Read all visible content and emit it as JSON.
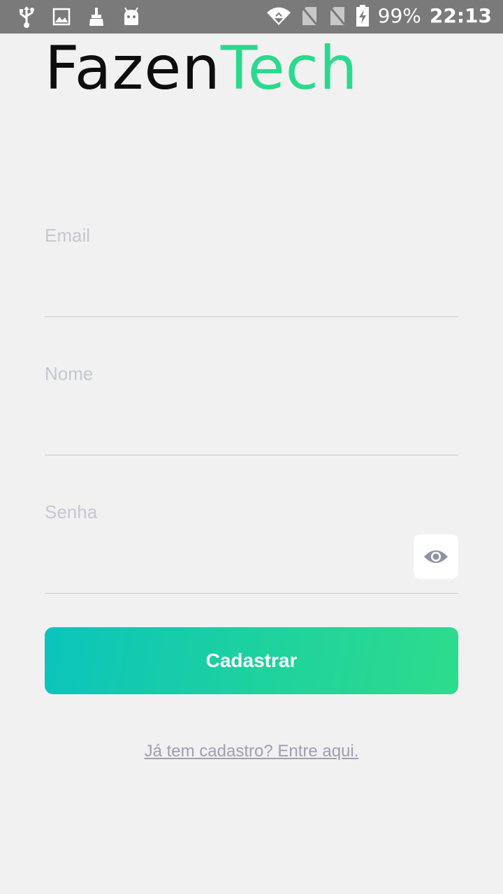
{
  "status_bar": {
    "battery": "99%",
    "time": "22:13",
    "left_icons": [
      "usb-icon",
      "image-icon",
      "cleaner-icon",
      "android-icon"
    ],
    "right_icons": [
      "wifi-icon",
      "no-sim-icon",
      "no-sim-icon",
      "battery-charging-icon"
    ]
  },
  "logo": {
    "part1": "Fazen",
    "part2": "Tech",
    "colors": {
      "part1": "#0d0d0d",
      "part2": "#2bd98d"
    }
  },
  "form": {
    "email_label": "Email",
    "email_value": "",
    "name_label": "Nome",
    "name_value": "",
    "password_label": "Senha",
    "password_value": "",
    "toggle_icon": "eye-icon"
  },
  "actions": {
    "submit_label": "Cadastrar",
    "login_link": "Já tem cadastro? Entre aqui."
  },
  "colors": {
    "background": "#f1f1f1",
    "status_bar": "#7a7a7a",
    "gradient_start": "#0bc4bc",
    "gradient_end": "#2ddc8c",
    "label": "#c3c7d2",
    "link": "#9ca0b0"
  }
}
